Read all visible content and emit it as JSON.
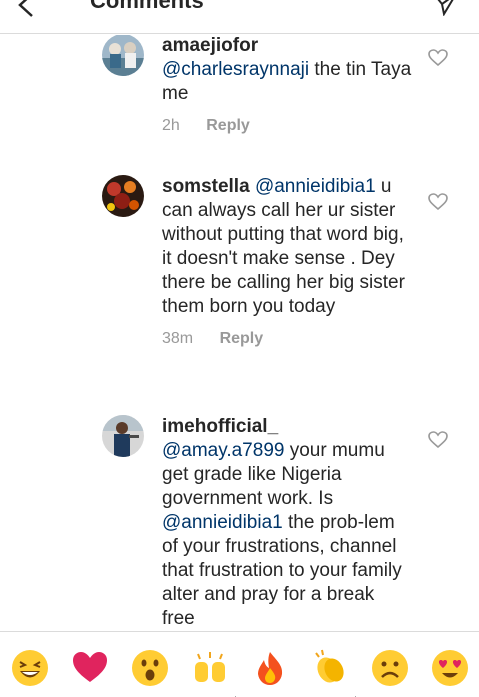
{
  "header": {
    "title": "Comments"
  },
  "comments": [
    {
      "username": "amaejiofor",
      "mention": "@charlesraynnaji",
      "text": " the tin Taya me",
      "time": "2h",
      "reply_label": "Reply"
    },
    {
      "username": "somstella",
      "mention": "@annieidibia1",
      "text": " u can always call her ur sister without putting that word big, it doesn't make sense . Dey there be calling her big sister them born you today",
      "time": "38m",
      "reply_label": "Reply"
    },
    {
      "username": "imehofficial_",
      "mention": "@amay.a7899",
      "text": " your mumu get grade like Nigeria government work. Is ",
      "mention2": "@annieidibia1",
      "text2": " the prob-lem of your frustrations, channel that frustration to your family alter and pray for a break free"
    }
  ],
  "emoji_bar": [
    {
      "icon": "laughing-face-icon",
      "glyph": "😂"
    },
    {
      "icon": "red-heart-icon",
      "glyph": "❤"
    },
    {
      "icon": "surprised-face-icon",
      "glyph": "😮"
    },
    {
      "icon": "raised-hands-icon",
      "glyph": "🙌"
    },
    {
      "icon": "fire-icon",
      "glyph": "🔥"
    },
    {
      "icon": "clapping-hands-icon",
      "glyph": "👏"
    },
    {
      "icon": "frowning-face-icon",
      "glyph": "☹"
    },
    {
      "icon": "heart-eyes-face-icon",
      "glyph": "😍"
    }
  ],
  "colors": {
    "text": "#262626",
    "mention": "#003569",
    "secondary": "#999999",
    "divider": "#dbdbdb",
    "heart": "#e0245e",
    "emoji_yellow": "#ffcc33"
  }
}
